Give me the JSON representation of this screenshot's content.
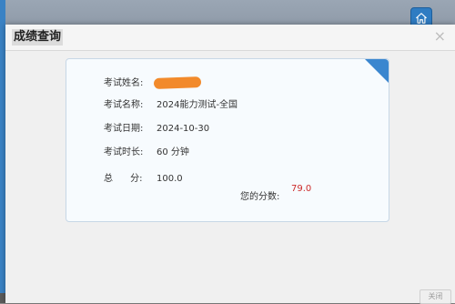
{
  "modal": {
    "title": "成绩查询",
    "close_glyph": "×",
    "footer_button": "关闭"
  },
  "exam": {
    "name_label": "考试姓名:",
    "title_label": "考试名称:",
    "title_value": "2024能力测试-全国",
    "date_label": "考试日期:",
    "date_value": "2024-10-30",
    "duration_label": "考试时长:",
    "duration_value": "60 分钟",
    "total_label": "总      分:",
    "total_value": "100.0",
    "score_label": "您的分数:",
    "score_value": "79.0"
  },
  "icons": {
    "home": "home-icon",
    "corner": "corner-ribbon-icon"
  },
  "colors": {
    "accent": "#3a86cf",
    "score": "#cc2b2b",
    "redaction": "#f28a2b"
  }
}
